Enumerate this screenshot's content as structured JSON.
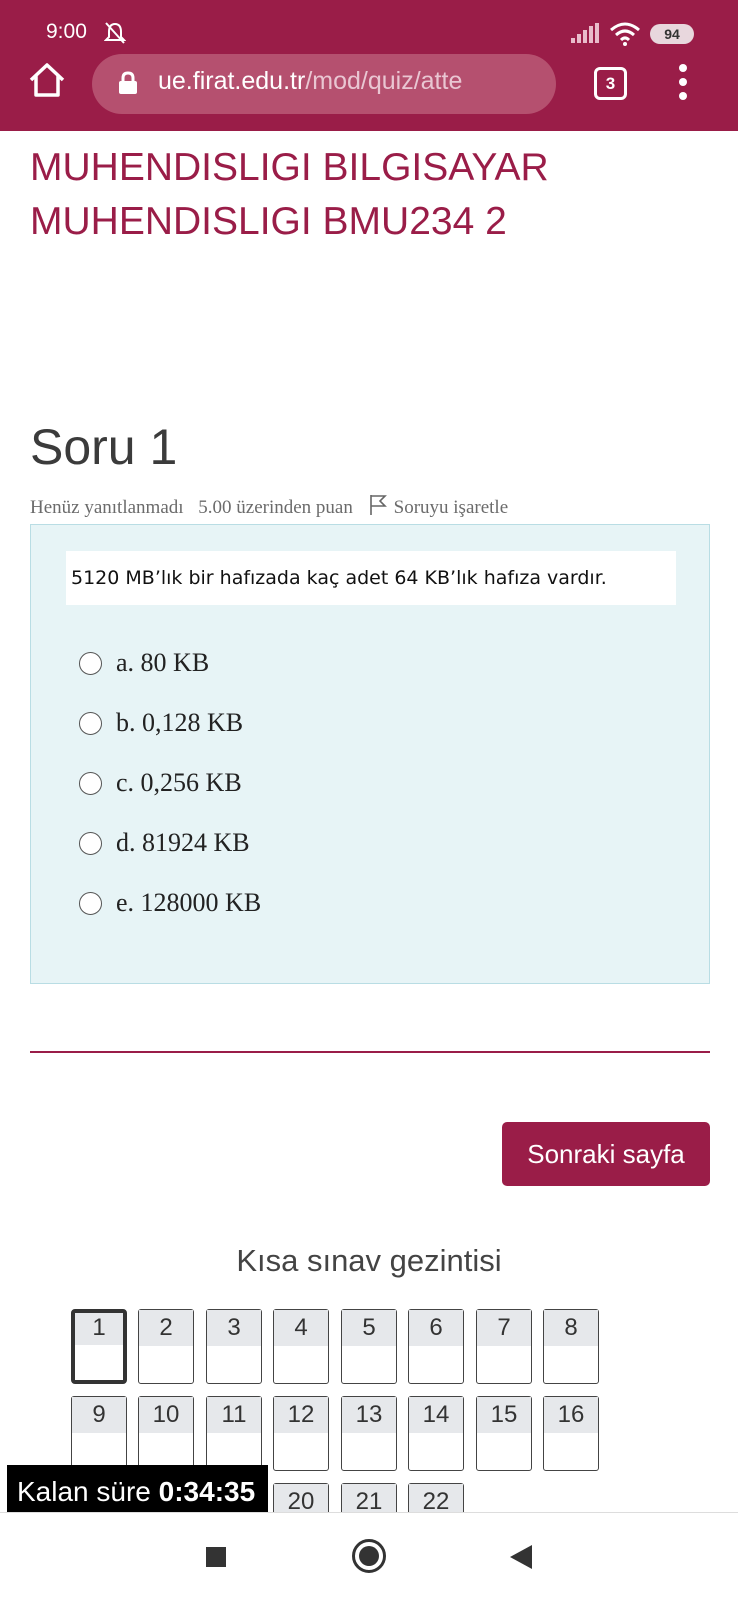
{
  "status_bar": {
    "time": "9:00",
    "battery": "94"
  },
  "browser": {
    "url_host": "ue.firat.edu.tr",
    "url_path": "/mod/quiz/atte",
    "tab_count": "3"
  },
  "course": {
    "title_line1": "MUHENDISLIGI BILGISAYAR",
    "title_line2": "MUHENDISLIGI BMU234 2"
  },
  "question": {
    "heading": "Soru 1",
    "status": "Henüz yanıtlanmadı",
    "points": "5.00 üzerinden puan",
    "flag_label": "Soruyu işaretle",
    "text": "5120 MB’lık bir hafızada kaç adet 64 KB’lık hafıza vardır.",
    "answers": [
      "a. 80 KB",
      "b. 0,128 KB",
      "c. 0,256 KB",
      "d. 81924 KB",
      "e. 128000 KB"
    ]
  },
  "next_button": "Sonraki sayfa",
  "quiz_nav": {
    "title": "Kısa sınav gezintisi",
    "current": "1",
    "buttons": [
      "1",
      "2",
      "3",
      "4",
      "5",
      "6",
      "7",
      "8",
      "9",
      "10",
      "11",
      "12",
      "13",
      "14",
      "15",
      "16",
      "20",
      "21",
      "22"
    ]
  },
  "timer": {
    "label": "Kalan süre",
    "value": "0:34:35"
  },
  "colors": {
    "brand": "#9a1d48",
    "question_bg": "#e7f4f6"
  }
}
